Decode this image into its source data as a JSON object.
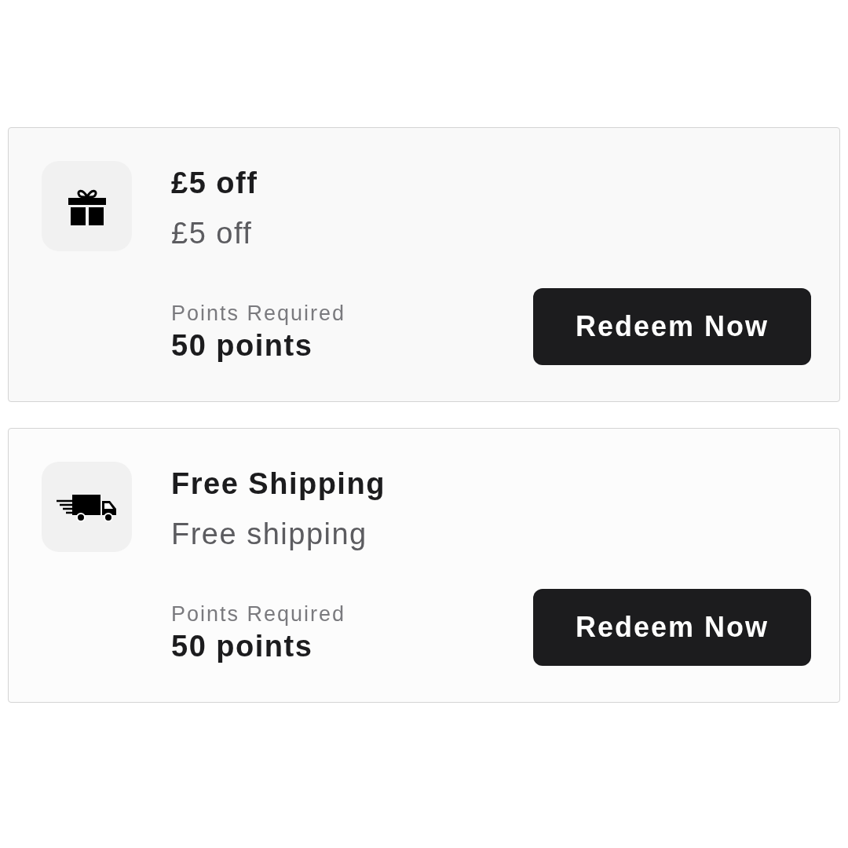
{
  "rewards": [
    {
      "kind": "gift",
      "title": "£5 off",
      "description": "£5 off",
      "points_label": "Points Required",
      "points": "50 points",
      "button": "Redeem Now"
    },
    {
      "kind": "truck",
      "title": "Free Shipping",
      "description": "Free shipping",
      "points_label": "Points Required",
      "points": "50 points",
      "button": "Redeem Now"
    }
  ]
}
